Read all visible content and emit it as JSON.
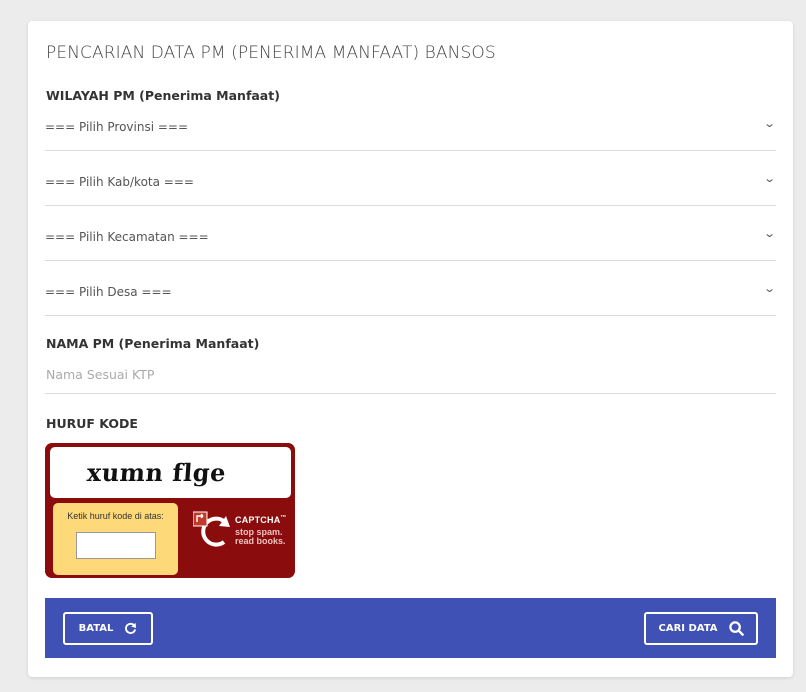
{
  "form": {
    "title": "PENCARIAN DATA PM (PENERIMA MANFAAT) BANSOS",
    "wilayah_label": "WILAYAH PM (Penerima Manfaat)",
    "selects": [
      {
        "value": "=== Pilih Provinsi ==="
      },
      {
        "value": "=== Pilih Kab/kota ==="
      },
      {
        "value": "=== Pilih Kecamatan ==="
      },
      {
        "value": "=== Pilih Desa ==="
      }
    ],
    "nama_label": "NAMA PM (Penerima Manfaat)",
    "nama_placeholder": "Nama Sesuai KTP",
    "nama_value": "",
    "kode_label": "HURUF KODE"
  },
  "captcha": {
    "word": "xumn flge",
    "prompt": "Ketik huruf kode di atas:",
    "input_value": "",
    "brand": "CAPTCHA",
    "trademark": "™",
    "tagline_1": "stop spam.",
    "tagline_2": "read books."
  },
  "footer": {
    "cancel_label": "BATAL",
    "search_label": "CARI DATA",
    "background": "#3f51b5"
  },
  "colors": {
    "captcha_frame": "#8a0c0c",
    "captcha_prompt_bg": "#fdd97a"
  }
}
